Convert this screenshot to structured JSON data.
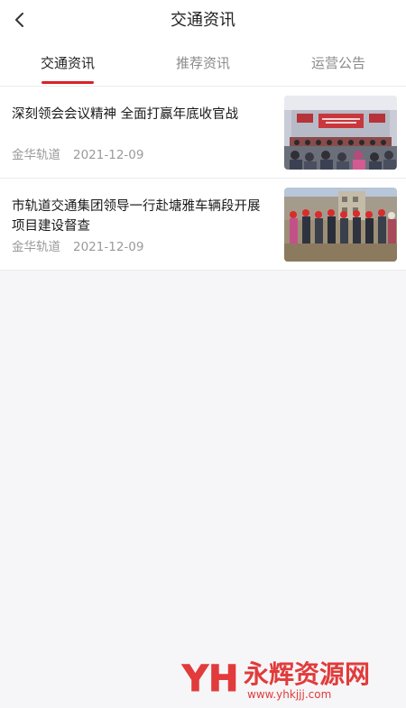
{
  "header": {
    "title": "交通资讯",
    "back_icon": "chevron-left-icon"
  },
  "tabs": [
    {
      "label": "交通资讯",
      "active": true
    },
    {
      "label": "推荐资讯",
      "active": false
    },
    {
      "label": "运营公告",
      "active": false
    }
  ],
  "news": [
    {
      "title": "深刻领会会议精神 全面打赢年底收官战",
      "source": "金华轨道",
      "date": "2021-12-09"
    },
    {
      "title": "市轨道交通集团领导一行赴塘雅车辆段开展项目建设督查",
      "source": "金华轨道",
      "date": "2021-12-09"
    }
  ],
  "watermark": {
    "logo_text": "YH",
    "name": "永辉资源网",
    "url": "www.yhkjjj.com"
  },
  "colors": {
    "accent": "#d8232a",
    "watermark": "#e23b3b"
  }
}
